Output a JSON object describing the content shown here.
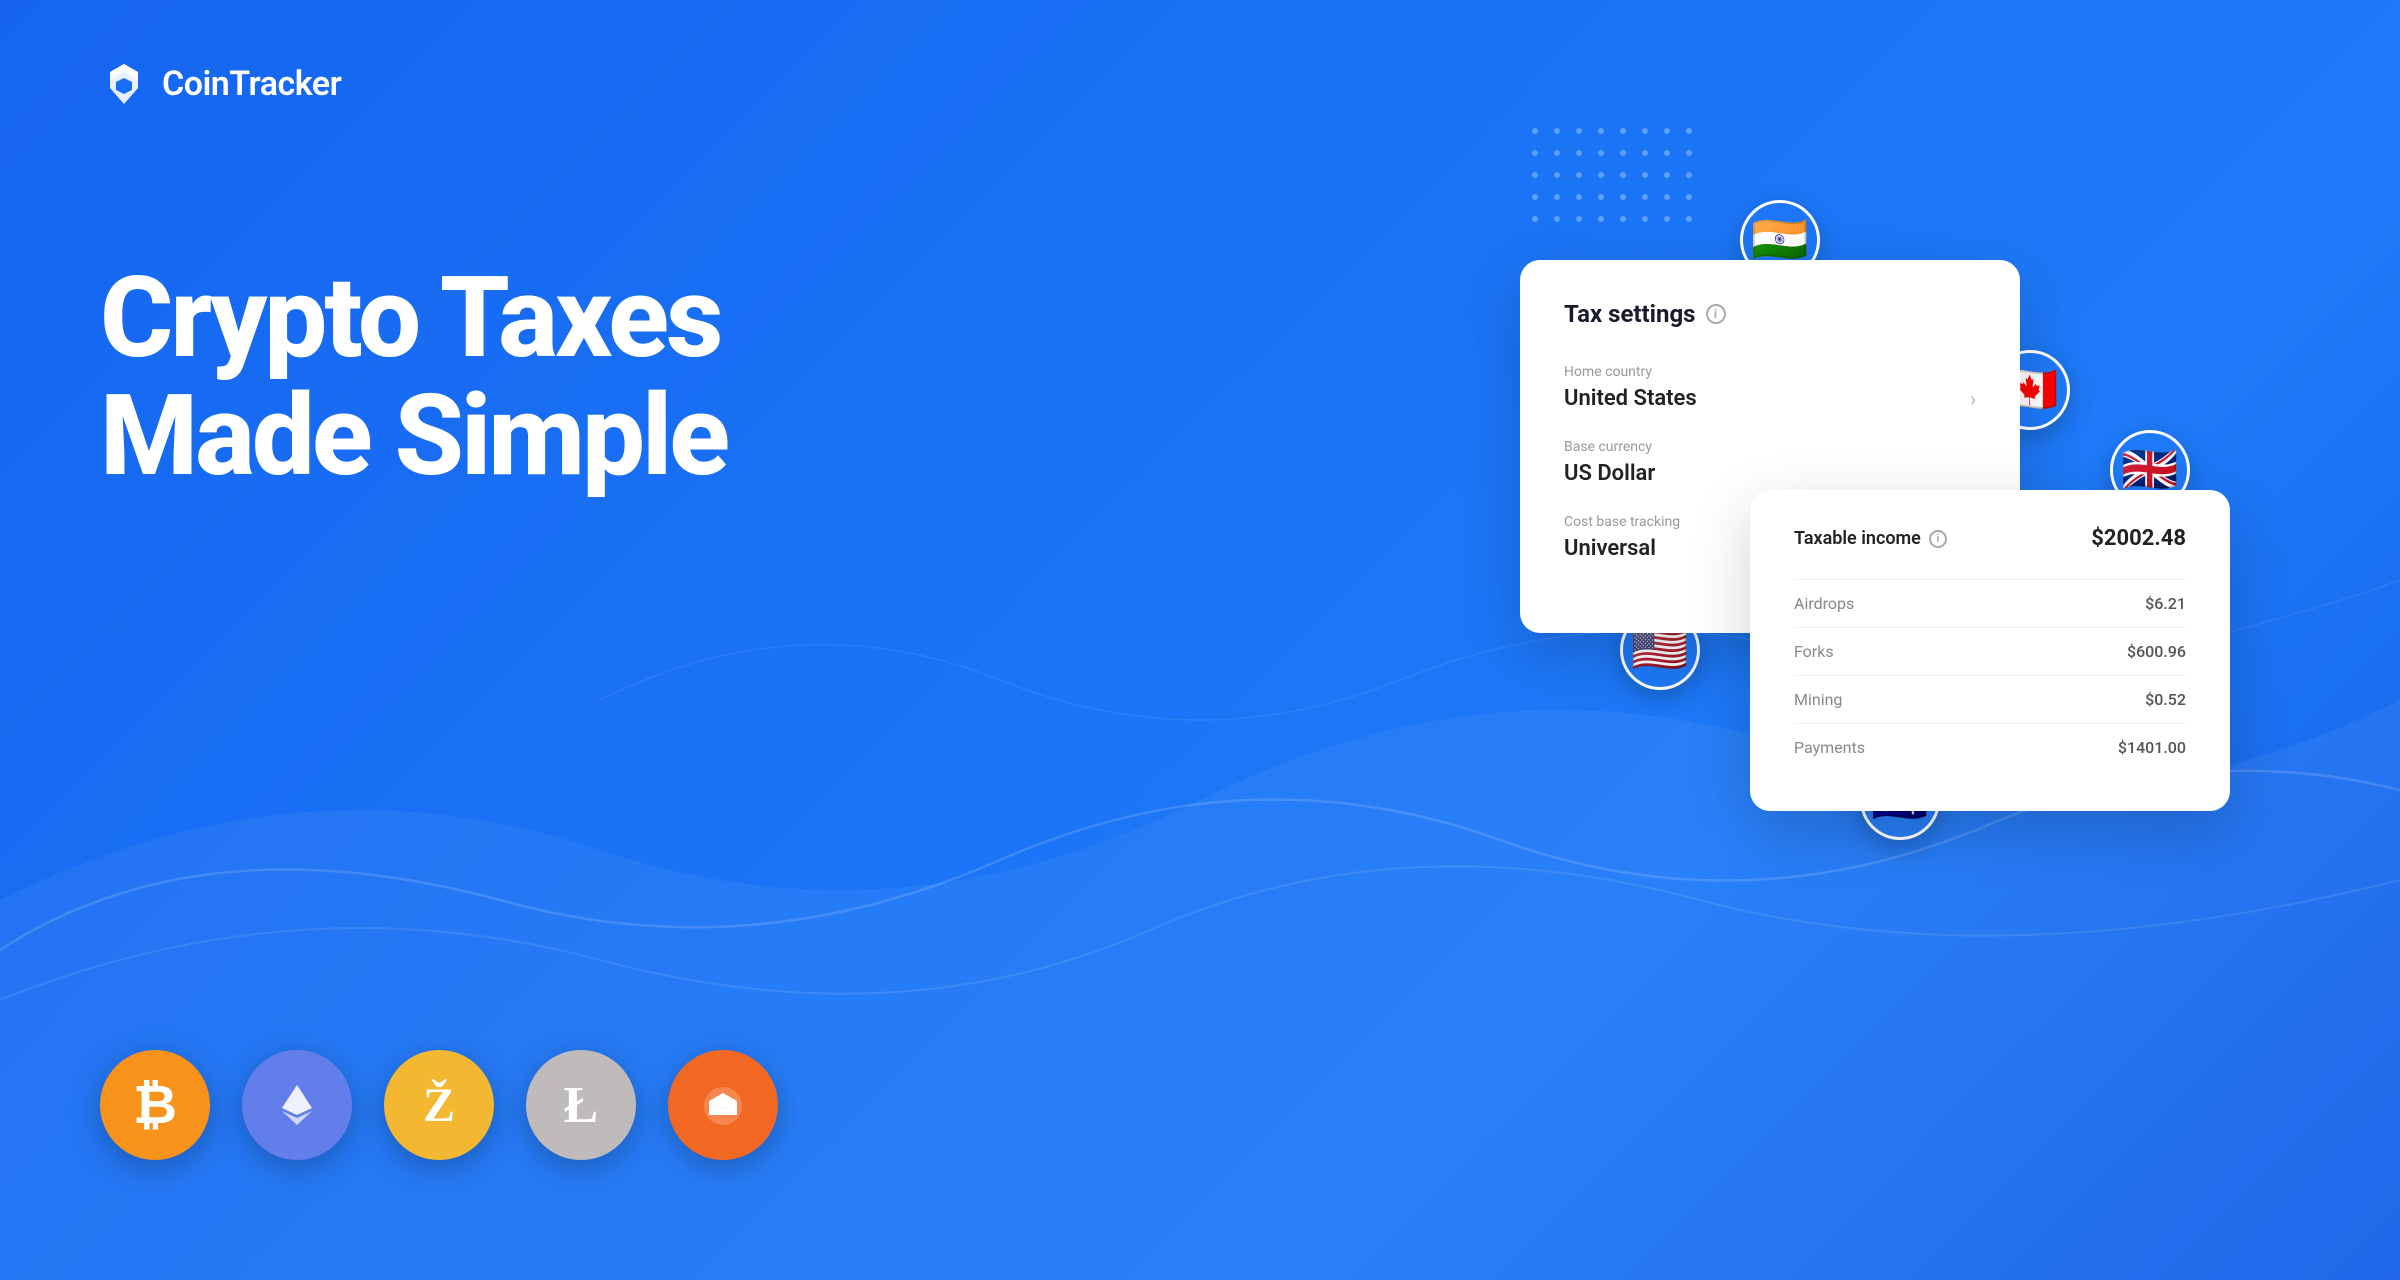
{
  "logo": {
    "text": "CoinTracker"
  },
  "headline": {
    "line1": "Crypto Taxes",
    "line2": "Made Simple"
  },
  "tax_card": {
    "title": "Tax settings",
    "home_country_label": "Home country",
    "home_country_value": "United States",
    "base_currency_label": "Base currency",
    "base_currency_value": "US Dollar",
    "cost_tracking_label": "Cost base tracking",
    "cost_tracking_value": "Universal"
  },
  "income_card": {
    "title": "Taxable income",
    "total": "$2002.48",
    "rows": [
      {
        "label": "Airdrops",
        "value": "$6.21"
      },
      {
        "label": "Forks",
        "value": "$600.96"
      },
      {
        "label": "Mining",
        "value": "$0.52"
      },
      {
        "label": "Payments",
        "value": "$1401.00"
      }
    ]
  },
  "coins": [
    {
      "symbol": "₿",
      "name": "bitcoin",
      "class": "coin-btc"
    },
    {
      "symbol": "⟠",
      "name": "ethereum",
      "class": "coin-eth"
    },
    {
      "symbol": "Ź",
      "name": "zcash",
      "class": "coin-zec"
    },
    {
      "symbol": "Ł",
      "name": "litecoin",
      "class": "coin-ltc"
    },
    {
      "symbol": "ɱ",
      "name": "monero",
      "class": "coin-xmr"
    }
  ],
  "flags": {
    "india": "🇮🇳",
    "canada": "🇨🇦",
    "uk": "🇬🇧",
    "usa": "🇺🇸",
    "australia": "🇦🇺"
  }
}
